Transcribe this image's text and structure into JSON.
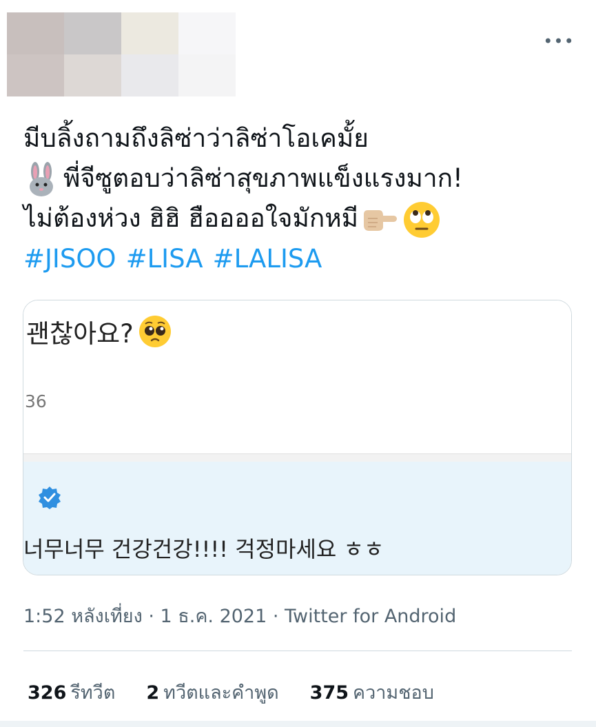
{
  "header": {
    "more_label": "•••"
  },
  "tweet": {
    "line1": "มีบลิ้งถามถึงลิซ่าว่าลิซ่าโอเคมั้ย",
    "line2": "พี่จีซูตอบว่าลิซ่าสุขภาพแข็งแรงมาก!",
    "line3": "ไม่ต้องห่วง ฮิฮิ  ฮืออออใจมักหมี",
    "hashtags": [
      "#JISOO",
      "#LISA",
      "#LALISA"
    ]
  },
  "media": {
    "question": "괜찮아요?",
    "count": "36",
    "answer": "너무너무 건강건강!!!! 걱정마세요 ㅎㅎ"
  },
  "meta": {
    "time": "1:52 หลังเที่ยง · 1 ธ.ค. 2021 · ",
    "source": "Twitter for Android"
  },
  "stats": {
    "retweets_count": "326",
    "retweets_label": "รีทวีต",
    "quotes_count": "2",
    "quotes_label": "ทวีตและคำพูด",
    "likes_count": "375",
    "likes_label": "ความชอบ"
  },
  "colors": {
    "accent": "#1d9bf0",
    "muted": "#536471",
    "card_bottom": "#e8f4fb"
  },
  "icons": [
    "more-icon",
    "rabbit-emoji",
    "pointing-hand-emoji",
    "rolling-eyes-emoji",
    "pleading-face-emoji",
    "verified-badge-icon"
  ]
}
